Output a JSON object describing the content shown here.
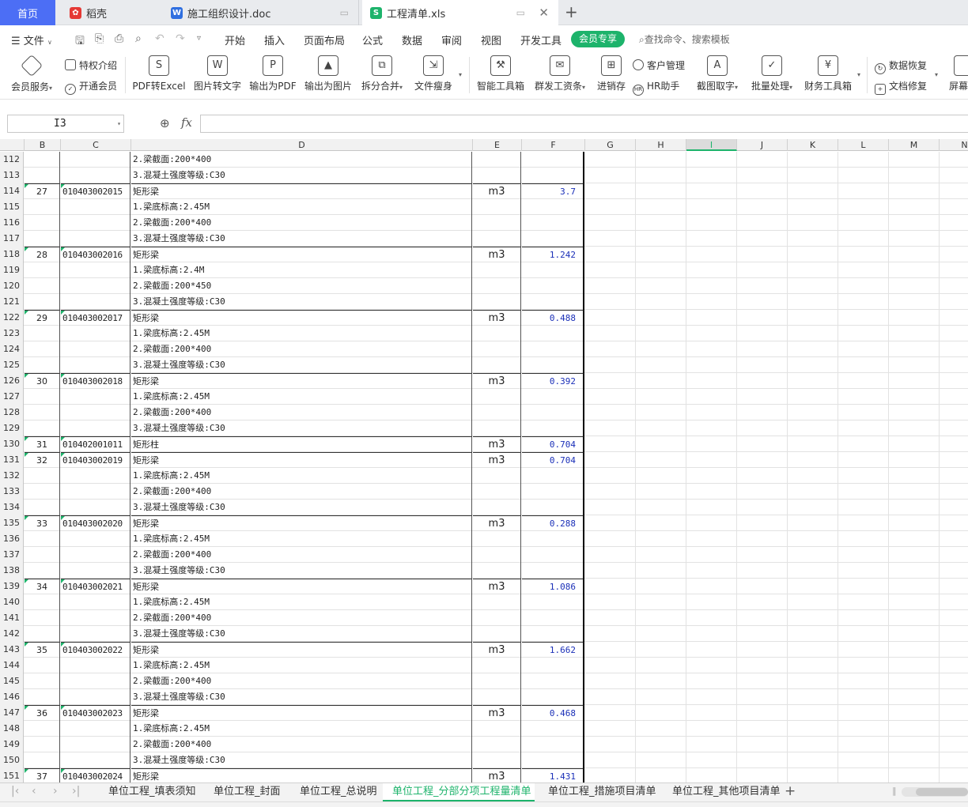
{
  "window_tabs": {
    "home": "首页",
    "daoke": "稻壳",
    "doc": "施工组织设计.doc",
    "xls": "工程清单.xls"
  },
  "menu": {
    "file": "文件",
    "items": [
      "开始",
      "插入",
      "页面布局",
      "公式",
      "数据",
      "审阅",
      "视图",
      "开发工具"
    ],
    "vip": "会员专享",
    "search_placeholder": "查找命令、搜索模板"
  },
  "ribbon": {
    "vip_service": "会员服务",
    "privilege": "特权介绍",
    "open_vip": "开通会员",
    "pdf_to_excel": "PDF转Excel",
    "img_to_text": "图片转文字",
    "export_pdf": "输出为PDF",
    "export_img": "输出为图片",
    "split_merge": "拆分合并",
    "slim": "文件瘦身",
    "smart_tools": "智能工具箱",
    "payroll": "群发工资条",
    "inventory": "进销存",
    "crm": "客户管理",
    "hr": "HR助手",
    "ocr": "截图取字",
    "batch": "批量处理",
    "finance": "财务工具箱",
    "recover": "数据恢复",
    "repair": "文档修复",
    "screen": "屏幕"
  },
  "formula_bar": {
    "name_box": "I3",
    "fx": "fx",
    "formula": ""
  },
  "columns": [
    "B",
    "C",
    "D",
    "E",
    "F",
    "G",
    "H",
    "I",
    "J",
    "K",
    "L",
    "M",
    "N"
  ],
  "rows": [
    {
      "n": "112",
      "b": "",
      "c": "",
      "d": "2.梁截面:200*400",
      "e": "",
      "f": ""
    },
    {
      "n": "113",
      "b": "",
      "c": "",
      "d": "3.混凝土强度等级:C30",
      "e": "",
      "f": ""
    },
    {
      "n": "114",
      "b": "27",
      "c": "010403002015",
      "d": "矩形梁",
      "e": "m3",
      "f": "3.7"
    },
    {
      "n": "115",
      "b": "",
      "c": "",
      "d": "1.梁底标高:2.45M",
      "e": "",
      "f": ""
    },
    {
      "n": "116",
      "b": "",
      "c": "",
      "d": "2.梁截面:200*400",
      "e": "",
      "f": ""
    },
    {
      "n": "117",
      "b": "",
      "c": "",
      "d": "3.混凝土强度等级:C30",
      "e": "",
      "f": ""
    },
    {
      "n": "118",
      "b": "28",
      "c": "010403002016",
      "d": "矩形梁",
      "e": "m3",
      "f": "1.242"
    },
    {
      "n": "119",
      "b": "",
      "c": "",
      "d": "1.梁底标高:2.4M",
      "e": "",
      "f": ""
    },
    {
      "n": "120",
      "b": "",
      "c": "",
      "d": "2.梁截面:200*450",
      "e": "",
      "f": ""
    },
    {
      "n": "121",
      "b": "",
      "c": "",
      "d": "3.混凝土强度等级:C30",
      "e": "",
      "f": ""
    },
    {
      "n": "122",
      "b": "29",
      "c": "010403002017",
      "d": "矩形梁",
      "e": "m3",
      "f": "0.488"
    },
    {
      "n": "123",
      "b": "",
      "c": "",
      "d": "1.梁底标高:2.45M",
      "e": "",
      "f": ""
    },
    {
      "n": "124",
      "b": "",
      "c": "",
      "d": "2.梁截面:200*400",
      "e": "",
      "f": ""
    },
    {
      "n": "125",
      "b": "",
      "c": "",
      "d": "3.混凝土强度等级:C30",
      "e": "",
      "f": ""
    },
    {
      "n": "126",
      "b": "30",
      "c": "010403002018",
      "d": "矩形梁",
      "e": "m3",
      "f": "0.392"
    },
    {
      "n": "127",
      "b": "",
      "c": "",
      "d": "1.梁底标高:2.45M",
      "e": "",
      "f": ""
    },
    {
      "n": "128",
      "b": "",
      "c": "",
      "d": "2.梁截面:200*400",
      "e": "",
      "f": ""
    },
    {
      "n": "129",
      "b": "",
      "c": "",
      "d": "3.混凝土强度等级:C30",
      "e": "",
      "f": ""
    },
    {
      "n": "130",
      "b": "31",
      "c": "010402001011",
      "d": "矩形柱",
      "e": "m3",
      "f": "0.704"
    },
    {
      "n": "131",
      "b": "32",
      "c": "010403002019",
      "d": "矩形梁",
      "e": "m3",
      "f": "0.704"
    },
    {
      "n": "132",
      "b": "",
      "c": "",
      "d": "1.梁底标高:2.45M",
      "e": "",
      "f": ""
    },
    {
      "n": "133",
      "b": "",
      "c": "",
      "d": "2.梁截面:200*400",
      "e": "",
      "f": ""
    },
    {
      "n": "134",
      "b": "",
      "c": "",
      "d": "3.混凝土强度等级:C30",
      "e": "",
      "f": ""
    },
    {
      "n": "135",
      "b": "33",
      "c": "010403002020",
      "d": "矩形梁",
      "e": "m3",
      "f": "0.288"
    },
    {
      "n": "136",
      "b": "",
      "c": "",
      "d": "1.梁底标高:2.45M",
      "e": "",
      "f": ""
    },
    {
      "n": "137",
      "b": "",
      "c": "",
      "d": "2.梁截面:200*400",
      "e": "",
      "f": ""
    },
    {
      "n": "138",
      "b": "",
      "c": "",
      "d": "3.混凝土强度等级:C30",
      "e": "",
      "f": ""
    },
    {
      "n": "139",
      "b": "34",
      "c": "010403002021",
      "d": "矩形梁",
      "e": "m3",
      "f": "1.086"
    },
    {
      "n": "140",
      "b": "",
      "c": "",
      "d": "1.梁底标高:2.45M",
      "e": "",
      "f": ""
    },
    {
      "n": "141",
      "b": "",
      "c": "",
      "d": "2.梁截面:200*400",
      "e": "",
      "f": ""
    },
    {
      "n": "142",
      "b": "",
      "c": "",
      "d": "3.混凝土强度等级:C30",
      "e": "",
      "f": ""
    },
    {
      "n": "143",
      "b": "35",
      "c": "010403002022",
      "d": "矩形梁",
      "e": "m3",
      "f": "1.662"
    },
    {
      "n": "144",
      "b": "",
      "c": "",
      "d": "1.梁底标高:2.45M",
      "e": "",
      "f": ""
    },
    {
      "n": "145",
      "b": "",
      "c": "",
      "d": "2.梁截面:200*400",
      "e": "",
      "f": ""
    },
    {
      "n": "146",
      "b": "",
      "c": "",
      "d": "3.混凝土强度等级:C30",
      "e": "",
      "f": ""
    },
    {
      "n": "147",
      "b": "36",
      "c": "010403002023",
      "d": "矩形梁",
      "e": "m3",
      "f": "0.468"
    },
    {
      "n": "148",
      "b": "",
      "c": "",
      "d": "1.梁底标高:2.45M",
      "e": "",
      "f": ""
    },
    {
      "n": "149",
      "b": "",
      "c": "",
      "d": "2.梁截面:200*400",
      "e": "",
      "f": ""
    },
    {
      "n": "150",
      "b": "",
      "c": "",
      "d": "3.混凝土强度等级:C30",
      "e": "",
      "f": ""
    },
    {
      "n": "151",
      "b": "37",
      "c": "010403002024",
      "d": "矩形梁",
      "e": "m3",
      "f": "1.431"
    }
  ],
  "sheet_tabs": [
    "单位工程_填表须知",
    "单位工程_封面",
    "单位工程_总说明",
    "单位工程_分部分项工程量清单",
    "单位工程_措施项目清单",
    "单位工程_其他项目清单"
  ],
  "active_sheet_index": 3,
  "colors": {
    "accent": "#1db36b",
    "home_tab": "#4c6ef5",
    "value_text": "#1a2fb8"
  }
}
